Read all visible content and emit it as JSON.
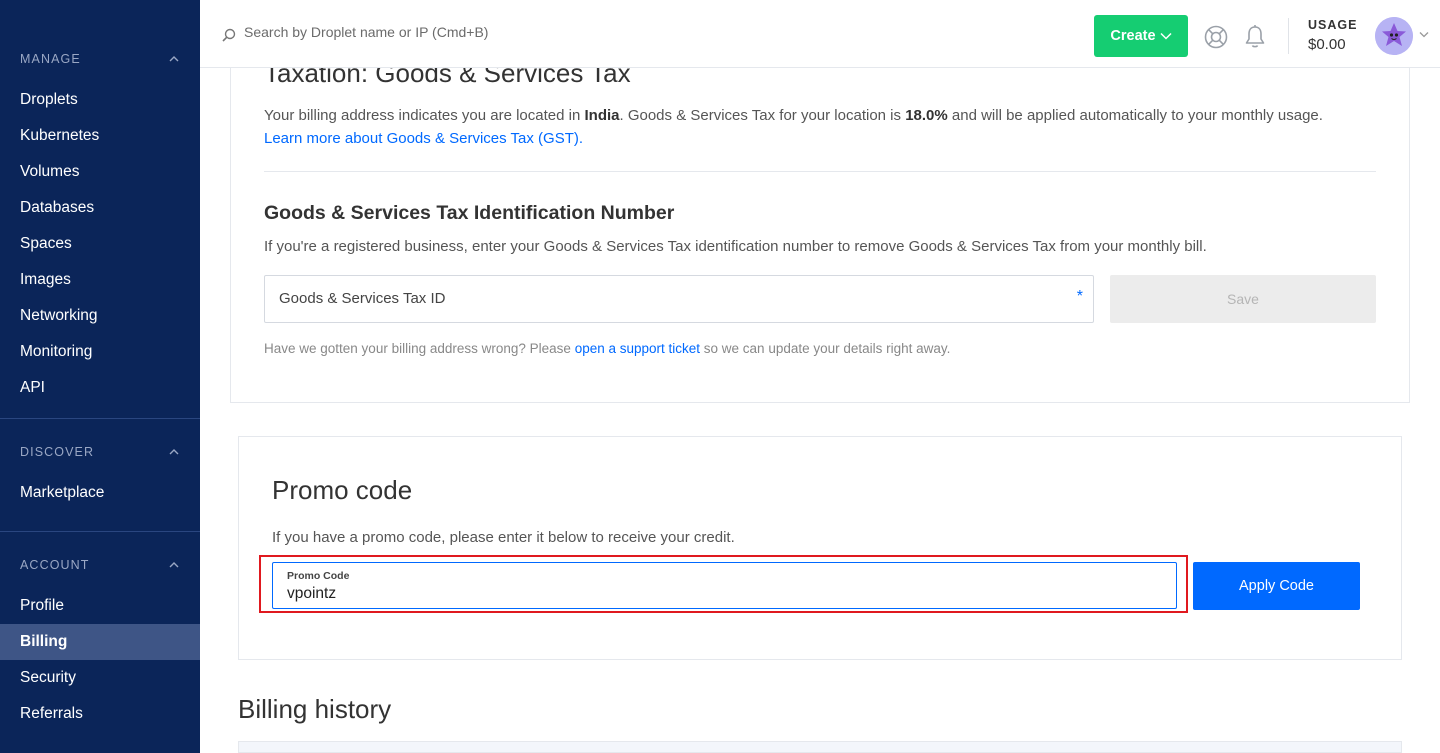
{
  "sidebar": {
    "sections": [
      {
        "title": "MANAGE",
        "items": [
          {
            "label": "Droplets"
          },
          {
            "label": "Kubernetes"
          },
          {
            "label": "Volumes"
          },
          {
            "label": "Databases"
          },
          {
            "label": "Spaces"
          },
          {
            "label": "Images"
          },
          {
            "label": "Networking"
          },
          {
            "label": "Monitoring"
          },
          {
            "label": "API"
          }
        ]
      },
      {
        "title": "DISCOVER",
        "items": [
          {
            "label": "Marketplace"
          }
        ]
      },
      {
        "title": "ACCOUNT",
        "items": [
          {
            "label": "Profile"
          },
          {
            "label": "Billing"
          },
          {
            "label": "Security"
          },
          {
            "label": "Referrals"
          }
        ]
      }
    ],
    "active_item": "Billing"
  },
  "topbar": {
    "search_placeholder": "Search by Droplet name or IP (Cmd+B)",
    "create_label": "Create",
    "usage_label": "USAGE",
    "usage_value": "$0.00"
  },
  "tax": {
    "title": "Taxation: Goods & Services Tax",
    "desc_prefix": "Your billing address indicates you are located in ",
    "location": "India",
    "desc_middle": ". Goods & Services Tax for your location is ",
    "rate": "18.0%",
    "desc_suffix": " and will be applied automatically to your monthly usage.",
    "learn_more": "Learn more about Goods & Services Tax (GST).",
    "gst_title": "Goods & Services Tax Identification Number",
    "gst_desc": "If you're a registered business, enter your Goods & Services Tax identification number to remove Goods & Services Tax from your monthly bill.",
    "gst_placeholder": "Goods & Services Tax ID",
    "required_mark": "*",
    "save_label": "Save",
    "note_prefix": "Have we gotten your billing address wrong? Please ",
    "note_link": "open a support ticket",
    "note_suffix": " so we can update your details right away."
  },
  "promo": {
    "title": "Promo code",
    "desc": "If you have a promo code, please enter it below to receive your credit.",
    "field_label": "Promo Code",
    "field_value": "vpointz",
    "apply_label": "Apply Code"
  },
  "history": {
    "title": "Billing history"
  },
  "colors": {
    "sidebar_bg": "#0b2559",
    "create_green": "#15cd72",
    "primary_blue": "#0069ff",
    "highlight_red": "#e0191f"
  }
}
